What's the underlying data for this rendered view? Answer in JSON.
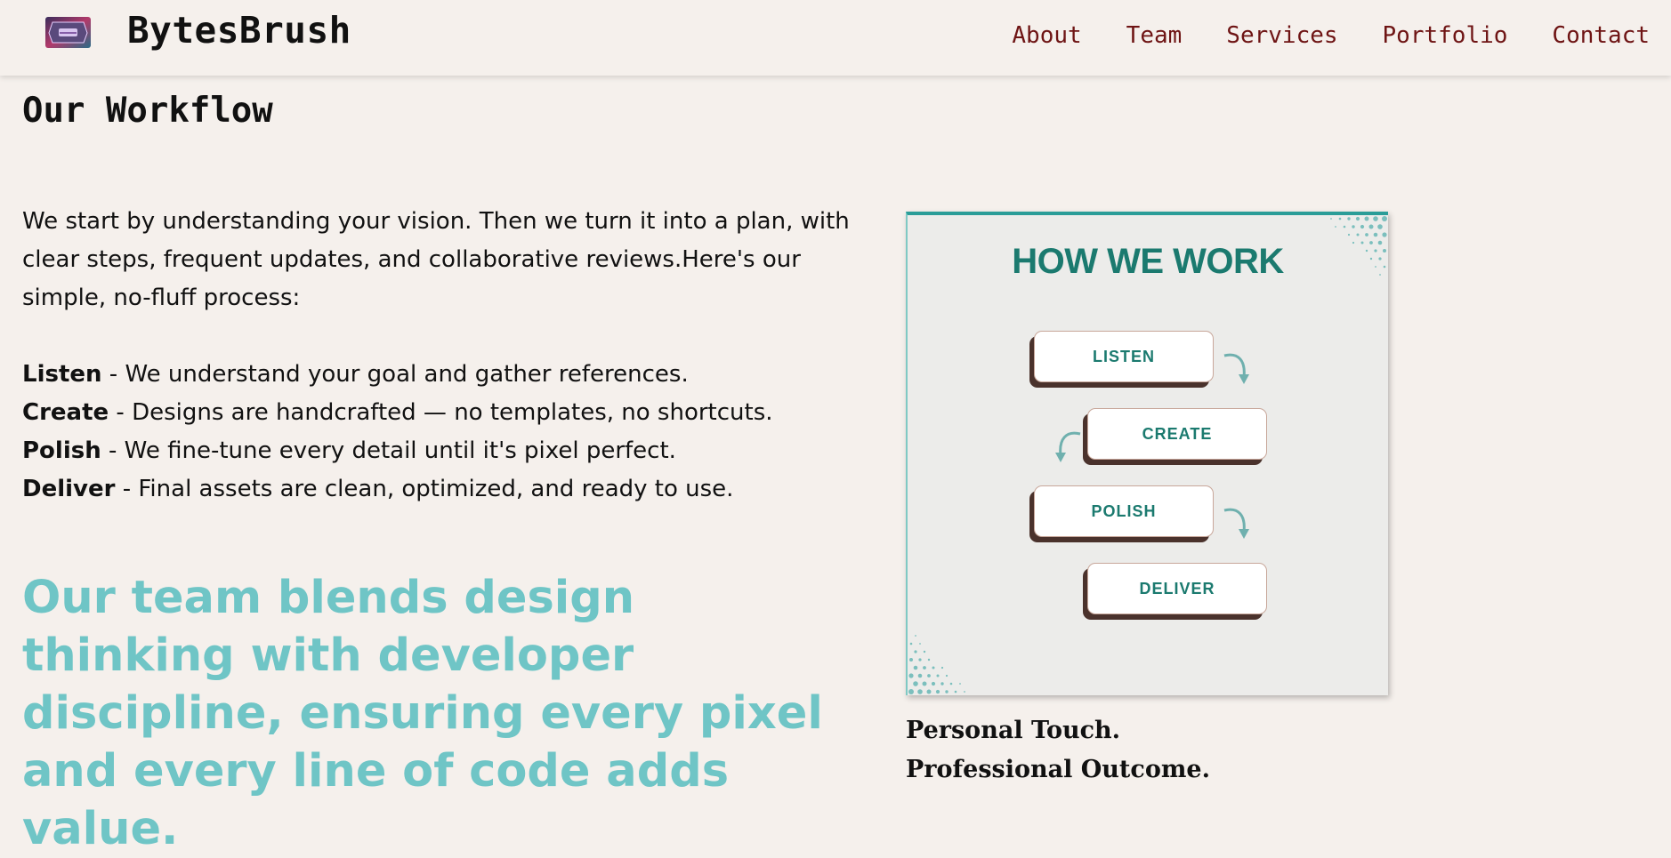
{
  "header": {
    "brand": "BytesBrush",
    "nav": [
      "About",
      "Team",
      "Services",
      "Portfolio",
      "Contact"
    ]
  },
  "main": {
    "title": "Our Workflow",
    "intro": "We start by understanding your vision. Then we turn it into a plan, with clear steps, frequent updates, and collaborative reviews.Here's our simple, no-fluff process:",
    "steps": [
      {
        "name": "Listen",
        "desc": " - We understand your goal and gather references."
      },
      {
        "name": "Create",
        "desc": " - Designs are handcrafted — no templates, no shortcuts."
      },
      {
        "name": "Polish",
        "desc": " - We fine-tune every detail until it's pixel perfect."
      },
      {
        "name": "Deliver",
        "desc": " - Final assets are clean, optimized, and ready to use."
      }
    ],
    "tagline": "Our team blends design thinking with developer discipline, ensuring every pixel and every line of code adds value."
  },
  "workflow_image": {
    "title": "HOW WE WORK",
    "steps": [
      "LISTEN",
      "CREATE",
      "POLISH",
      "DELIVER"
    ]
  },
  "caption": {
    "line1": "Personal Touch.",
    "line2": "Professional Outcome."
  },
  "colors": {
    "background": "#f5f0ec",
    "nav_text": "#6e1414",
    "tagline": "#6fc5c6",
    "card_accent": "#2a9d98",
    "card_title": "#1b7a6f"
  }
}
